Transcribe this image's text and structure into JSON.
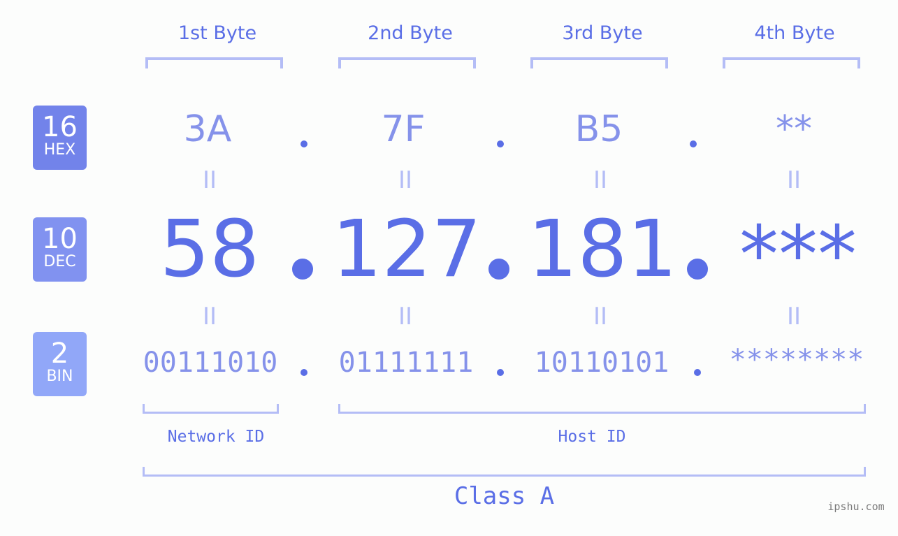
{
  "bytes": [
    {
      "label": "1st Byte",
      "hex": "3A",
      "dec": "58",
      "bin": "00111010"
    },
    {
      "label": "2nd Byte",
      "hex": "7F",
      "dec": "127",
      "bin": "01111111"
    },
    {
      "label": "3rd Byte",
      "hex": "B5",
      "dec": "181",
      "bin": "10110101"
    },
    {
      "label": "4th Byte",
      "hex": "**",
      "dec": "***",
      "bin": "********"
    }
  ],
  "badges": {
    "hex": {
      "num": "16",
      "label": "HEX",
      "color": "#7283ea"
    },
    "dec": {
      "num": "10",
      "label": "DEC",
      "color": "#8192f0"
    },
    "bin": {
      "num": "2",
      "label": "BIN",
      "color": "#91a7f8"
    }
  },
  "equals_glyph": "II",
  "network_id_label": "Network ID",
  "host_id_label": "Host ID",
  "class_label": "Class A",
  "watermark": "ipshu.com",
  "colors": {
    "primary": "#5a6ee6",
    "secondary": "#8592ea",
    "bracket": "#b4bdf6",
    "background": "#fcfdfc"
  }
}
